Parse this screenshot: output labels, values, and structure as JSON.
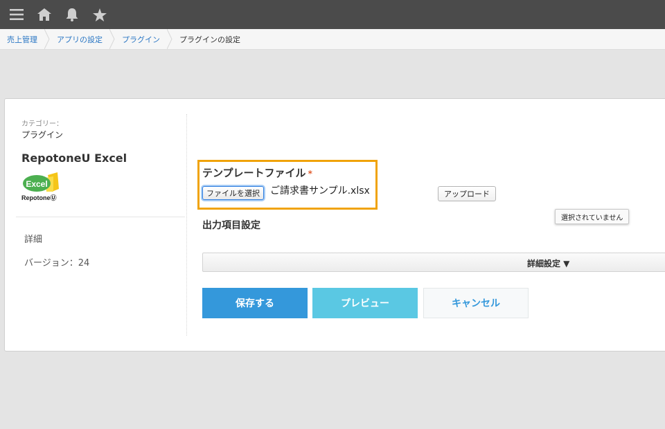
{
  "topbar": {
    "icons": [
      "menu-icon",
      "home-icon",
      "bell-icon",
      "star-icon"
    ]
  },
  "breadcrumb": {
    "items": [
      "売上管理",
      "アプリの設定",
      "プラグイン",
      "プラグインの設定"
    ]
  },
  "sidebar": {
    "category_label": "カテゴリー：",
    "category_value": "プラグイン",
    "plugin_name": "RepotoneU Excel",
    "logo_text": "Excel",
    "logo_brand": "RepotoneⓊ",
    "detail_link": "詳細",
    "version": "バージョン：24"
  },
  "template": {
    "title": "テンプレートファイル",
    "required_mark": "*",
    "choose_button": "ファイルを選択",
    "file_name": "ご請求書サンプル.xlsx",
    "upload_button": "アップロード",
    "tooltip": "選択されていません"
  },
  "output": {
    "title": "出力項目設定",
    "detail_toggle": "詳細設定 ▼"
  },
  "actions": {
    "save": "保存する",
    "preview": "プレビュー",
    "cancel": "キャンセル"
  },
  "colors": {
    "accent": "#3498db",
    "preview": "#5ac8e3",
    "highlight": "#f0a30a",
    "topbar": "#4b4b4b"
  }
}
